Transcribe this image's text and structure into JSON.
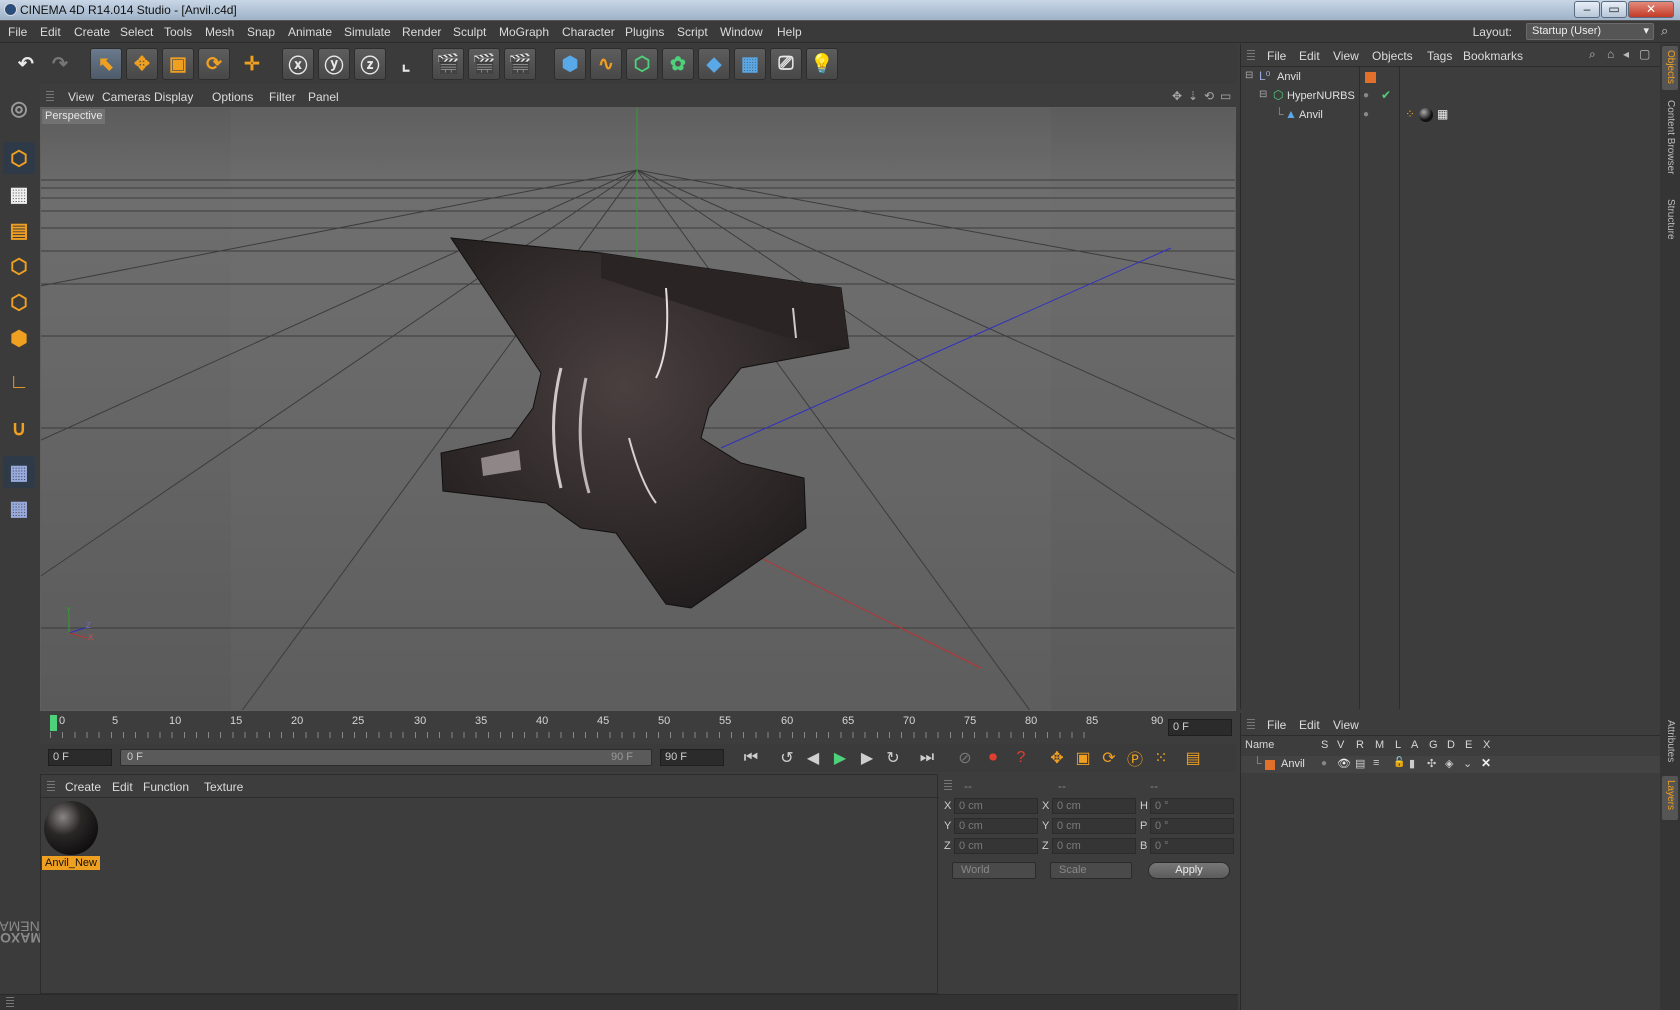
{
  "app": {
    "title": "CINEMA 4D R14.014 Studio - [Anvil.c4d]"
  },
  "window_controls": {
    "minimize": "–",
    "maximize": "▭",
    "close": "✕"
  },
  "menu": [
    "File",
    "Edit",
    "Create",
    "Select",
    "Tools",
    "Mesh",
    "Snap",
    "Animate",
    "Simulate",
    "Render",
    "Sculpt",
    "MoGraph",
    "Character",
    "Plugins",
    "Script",
    "Window",
    "Help"
  ],
  "layout": {
    "label": "Layout:",
    "value": "Startup (User)"
  },
  "viewport": {
    "menu": [
      "View",
      "Cameras",
      "Display",
      "Options",
      "Filter",
      "Panel"
    ],
    "label": "Perspective",
    "axis_labels": {
      "y": "Y",
      "x": "X",
      "z": "Z"
    }
  },
  "timeline": {
    "ticks": [
      "0",
      "5",
      "10",
      "15",
      "20",
      "25",
      "30",
      "35",
      "40",
      "45",
      "50",
      "55",
      "60",
      "65",
      "70",
      "75",
      "80",
      "85",
      "90"
    ],
    "current_frame": "0 F"
  },
  "transport": {
    "start_field": "0 F",
    "range_start": "0 F",
    "range_end": "90 F",
    "end_field": "90 F"
  },
  "material_manager": {
    "menu": [
      "Create",
      "Edit",
      "Function",
      "Texture"
    ],
    "materials": [
      {
        "name": "Anvil_New"
      }
    ]
  },
  "coordinates": {
    "headers": [
      "--",
      "--",
      "--"
    ],
    "rows": [
      {
        "l1": "X",
        "v1": "0 cm",
        "l2": "X",
        "v2": "0 cm",
        "l3": "H",
        "v3": "0 °"
      },
      {
        "l1": "Y",
        "v1": "0 cm",
        "l2": "Y",
        "v2": "0 cm",
        "l3": "P",
        "v3": "0 °"
      },
      {
        "l1": "Z",
        "v1": "0 cm",
        "l2": "Z",
        "v2": "0 cm",
        "l3": "B",
        "v3": "0 °"
      }
    ],
    "world": "World",
    "scale": "Scale",
    "apply": "Apply"
  },
  "object_manager": {
    "menu": [
      "File",
      "Edit",
      "View",
      "Objects",
      "Tags",
      "Bookmarks"
    ],
    "objects": [
      {
        "name": "Anvil",
        "indent": 0
      },
      {
        "name": "HyperNURBS",
        "indent": 1
      },
      {
        "name": "Anvil",
        "indent": 2
      }
    ]
  },
  "layer_manager": {
    "menu": [
      "File",
      "Edit",
      "View"
    ],
    "columns": [
      "Name",
      "S",
      "V",
      "R",
      "M",
      "L",
      "A",
      "G",
      "D",
      "E",
      "X"
    ],
    "layers": [
      {
        "name": "Anvil",
        "color": "#e0702a"
      }
    ]
  },
  "side_tabs": [
    "Objects",
    "Content Browser",
    "Structure",
    "Attributes",
    "Layers"
  ],
  "brand": {
    "maxon": "MAXON",
    "product": "CINEMA 4D"
  },
  "colors": {
    "accent_orange": "#f0a020",
    "grid_green": "#2fa02f",
    "axis_blue": "#3030c0",
    "axis_red": "#c03030",
    "layer_orange": "#e0702a"
  }
}
